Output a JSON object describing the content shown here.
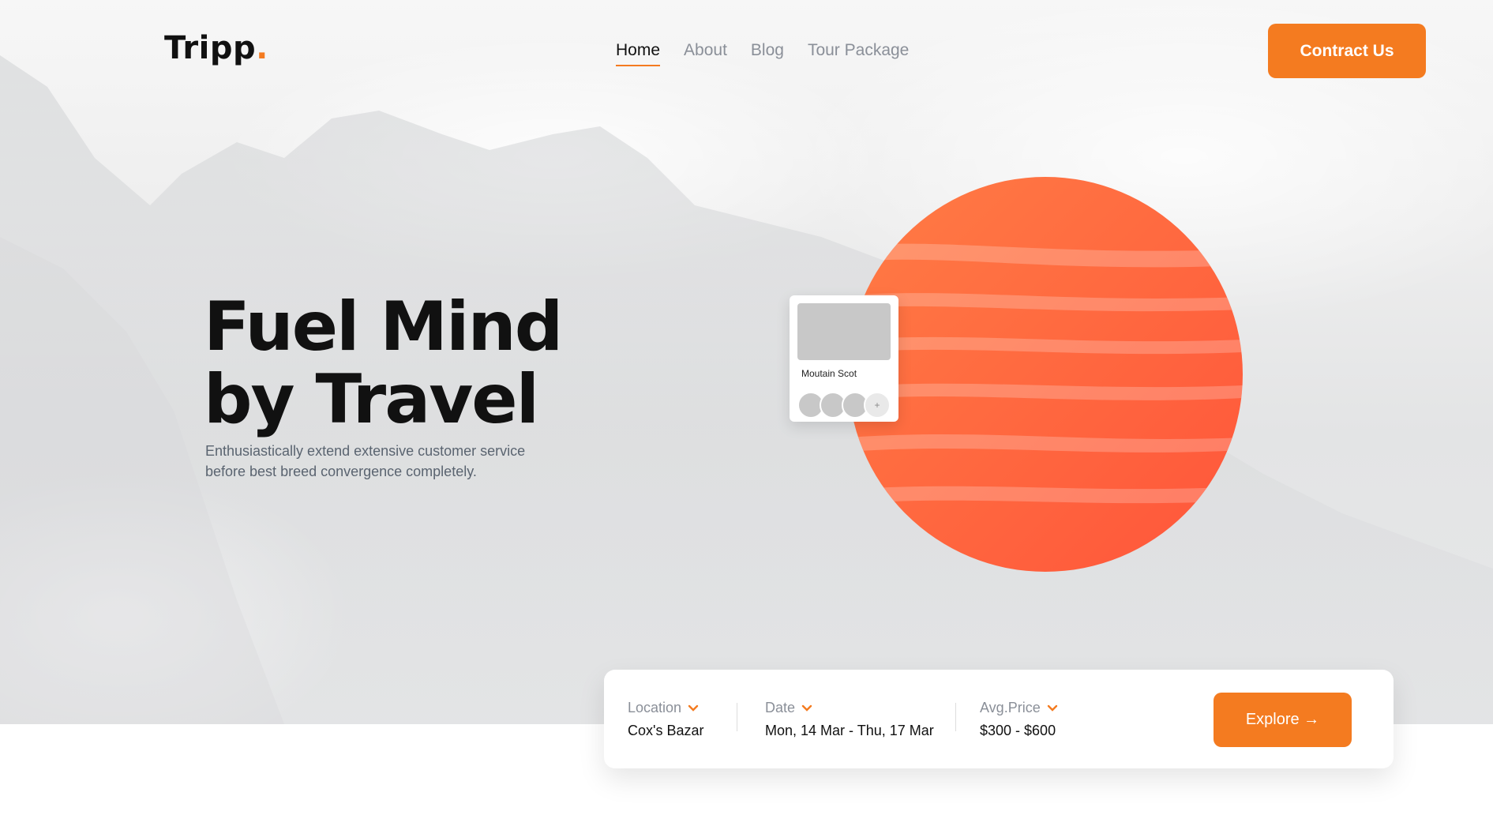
{
  "brand": {
    "name": "Tripp",
    "dot": ".",
    "accent_color": "#f47b20"
  },
  "nav": {
    "items": [
      {
        "label": "Home",
        "active": true
      },
      {
        "label": "About",
        "active": false
      },
      {
        "label": "Blog",
        "active": false
      },
      {
        "label": "Tour Package",
        "active": false
      }
    ]
  },
  "header": {
    "cta_label": "Contract Us"
  },
  "hero": {
    "title_line1": "Fuel Mind",
    "title_line2": "by Travel",
    "subtitle": "Enthusiastically extend extensive customer service before best breed convergence completely."
  },
  "place_card": {
    "name": "Moutain Scot",
    "avatar_more": "+"
  },
  "search": {
    "location": {
      "label": "Location",
      "value": "Cox's Bazar",
      "icon": "chevron-down-icon"
    },
    "date": {
      "label": "Date",
      "value": "Mon, 14 Mar - Thu, 17 Mar",
      "icon": "chevron-down-icon"
    },
    "price": {
      "label": "Avg.Price",
      "value": "$300 - $600",
      "icon": "chevron-down-icon"
    },
    "explore_label": "Explore →"
  },
  "colors": {
    "sun_top": "#ff7a45",
    "sun_bottom": "#ff5a3c",
    "text_dark": "#111111",
    "text_muted": "#8a8f98"
  }
}
